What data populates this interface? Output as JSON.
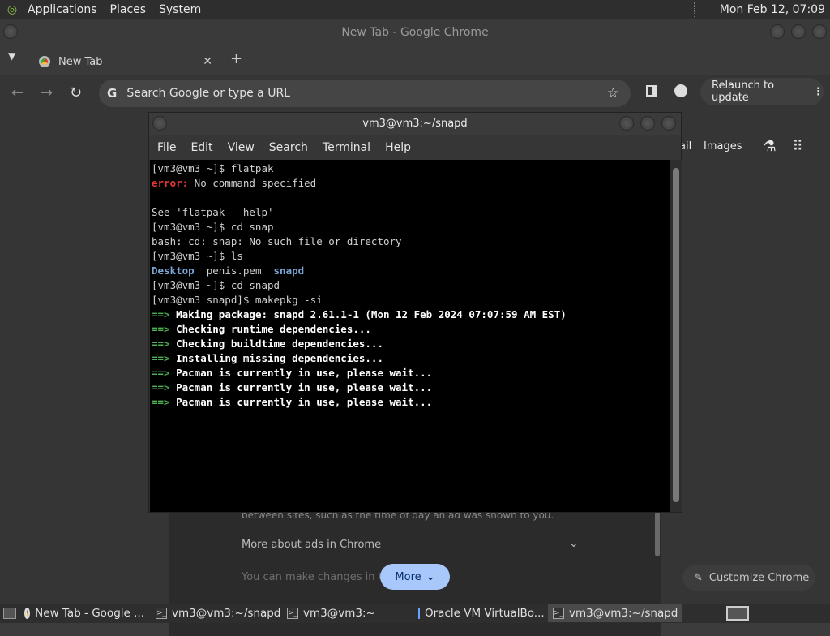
{
  "top_panel": {
    "menus": [
      "Applications",
      "Places",
      "System"
    ],
    "clock": "Mon Feb 12, 07:09"
  },
  "chrome": {
    "window_title": "New Tab - Google Chrome",
    "tab_title": "New Tab",
    "omnibox_placeholder": "Search Google or type a URL",
    "relaunch_label": "Relaunch to update",
    "ntp": {
      "gmail_partial": "ail",
      "images_label": "Images",
      "ad_fade_text": "between sites, such as the time of day an ad was shown to you.",
      "more_about_ads": "More about ads in Chrome",
      "changes_text": "You can make changes in Chro",
      "more_button": "More",
      "customize_button": "Customize Chrome"
    }
  },
  "terminal": {
    "title": "vm3@vm3:~/snapd",
    "menu": [
      "File",
      "Edit",
      "View",
      "Search",
      "Terminal",
      "Help"
    ],
    "lines": [
      {
        "t": "prompt",
        "text": "[vm3@vm3 ~]$ flatpak"
      },
      {
        "t": "error",
        "label": "error:",
        "text": " No command specified"
      },
      {
        "t": "plain",
        "text": ""
      },
      {
        "t": "plain",
        "text": "See 'flatpak --help'"
      },
      {
        "t": "prompt",
        "text": "[vm3@vm3 ~]$ cd snap"
      },
      {
        "t": "plain",
        "text": "bash: cd: snap: No such file or directory"
      },
      {
        "t": "prompt",
        "text": "[vm3@vm3 ~]$ ls"
      },
      {
        "t": "ls",
        "items": [
          "Desktop",
          "penis.pem",
          "snapd"
        ]
      },
      {
        "t": "prompt",
        "text": "[vm3@vm3 ~]$ cd snapd"
      },
      {
        "t": "prompt",
        "text": "[vm3@vm3 snapd]$ makepkg -si"
      },
      {
        "t": "arrow",
        "text": "Making package: snapd 2.61.1-1 (Mon 12 Feb 2024 07:07:59 AM EST)"
      },
      {
        "t": "arrow",
        "text": "Checking runtime dependencies..."
      },
      {
        "t": "arrow",
        "text": "Checking buildtime dependencies..."
      },
      {
        "t": "arrow",
        "text": "Installing missing dependencies..."
      },
      {
        "t": "arrow",
        "text": "Pacman is currently in use, please wait..."
      },
      {
        "t": "arrow",
        "text": "Pacman is currently in use, please wait..."
      },
      {
        "t": "arrow",
        "text": "Pacman is currently in use, please wait..."
      }
    ]
  },
  "taskbar": {
    "items": [
      {
        "label": "New Tab - Google ...",
        "icon": "chrome-icon",
        "active": false
      },
      {
        "label": "vm3@vm3:~/snapd",
        "icon": "terminal-icon",
        "active": false
      },
      {
        "label": "vm3@vm3:~",
        "icon": "terminal-icon",
        "active": false
      },
      {
        "label": "Oracle VM VirtualBo...",
        "icon": "virtualbox-icon",
        "active": false
      },
      {
        "label": "vm3@vm3:~/snapd",
        "icon": "terminal-icon",
        "active": true
      }
    ]
  }
}
